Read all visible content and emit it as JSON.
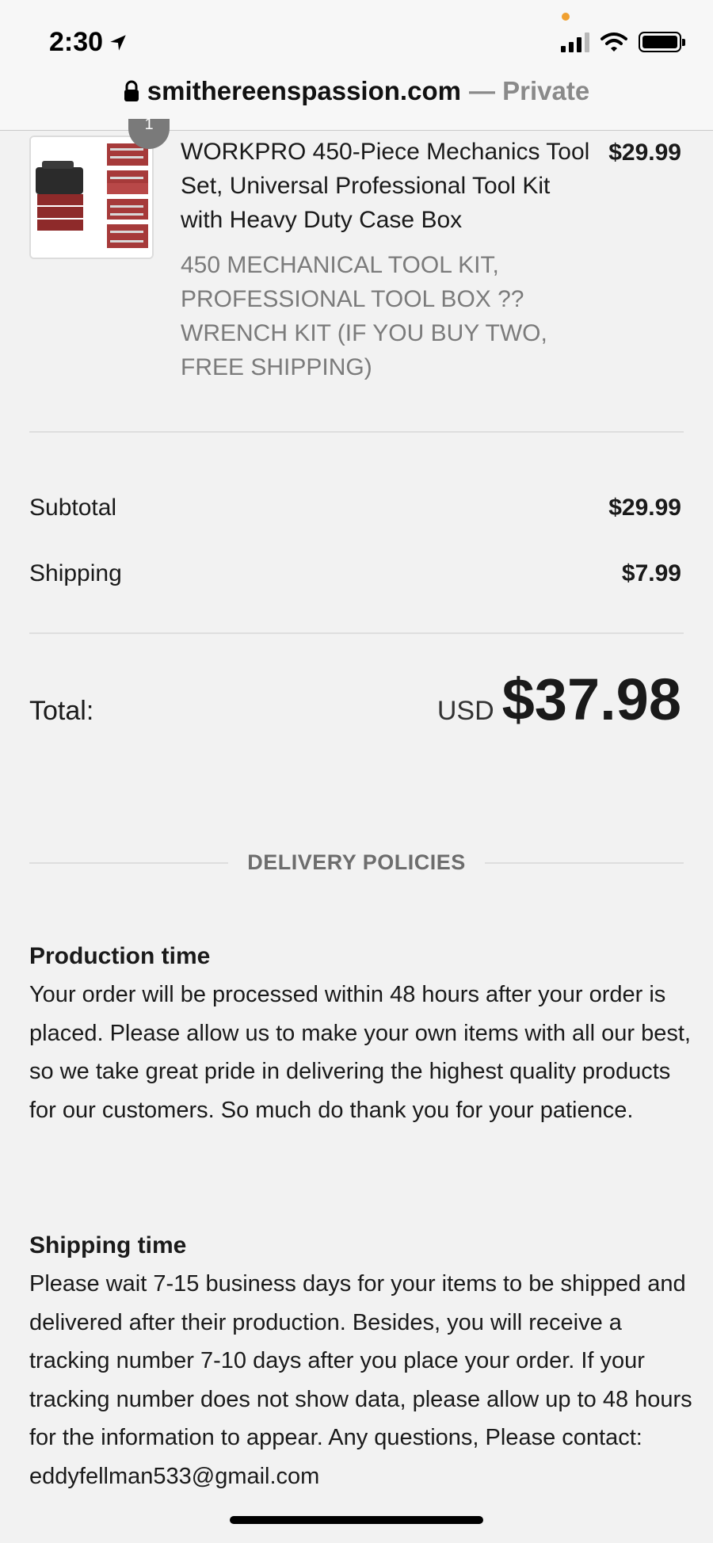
{
  "status_bar": {
    "time": "2:30",
    "icons": [
      "location-arrow-icon",
      "cellular-signal-icon",
      "wifi-icon",
      "battery-icon"
    ]
  },
  "url_bar": {
    "domain": "smithereenspassion.com",
    "suffix": "— Private"
  },
  "product": {
    "quantity": "1",
    "title": "WORKPRO 450-Piece Mechanics Tool Set, Universal Professional Tool Kit with Heavy Duty Case Box",
    "variant": "450 MECHANICAL TOOL KIT, PROFESSIONAL TOOL BOX ?? WRENCH KIT (IF YOU BUY TWO, FREE SHIPPING)",
    "price": "$29.99"
  },
  "summary": {
    "subtotal_label": "Subtotal",
    "subtotal_value": "$29.99",
    "shipping_label": "Shipping",
    "shipping_value": "$7.99",
    "total_label": "Total:",
    "total_currency": "USD",
    "total_value": "$37.98"
  },
  "policies": {
    "heading": "DELIVERY POLICIES",
    "production": {
      "title": "Production time",
      "body": "Your order will be processed within 48 hours after your order is placed. Please allow us to make your own items with all our best, so we take great pride in delivering the highest quality products for our customers. So much do thank you for your patience."
    },
    "shipping": {
      "title": "Shipping time",
      "body": "Please wait 7-15 business days for your items to be shipped and delivered after their production. Besides, you will receive a tracking number 7-10 days after you place your order. If your tracking number does not show data, please allow up to 48 hours for the information to appear. Any questions, Please contact: eddyfellman533@gmail.com"
    }
  },
  "colors": {
    "background": "#f2f2f2",
    "muted_text": "#7b7b7b",
    "accent_dot": "#f0a030"
  }
}
